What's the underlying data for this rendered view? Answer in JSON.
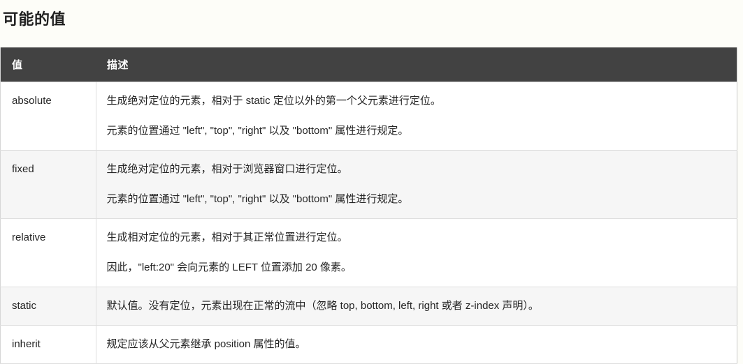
{
  "page": {
    "title": "可能的值"
  },
  "table": {
    "headers": {
      "value": "值",
      "description": "描述"
    },
    "rows": [
      {
        "value": "absolute",
        "lines": [
          "生成绝对定位的元素，相对于 static 定位以外的第一个父元素进行定位。",
          "元素的位置通过 \"left\", \"top\", \"right\" 以及 \"bottom\" 属性进行规定。"
        ]
      },
      {
        "value": "fixed",
        "lines": [
          "生成绝对定位的元素，相对于浏览器窗口进行定位。",
          "元素的位置通过 \"left\", \"top\", \"right\" 以及 \"bottom\" 属性进行规定。"
        ]
      },
      {
        "value": "relative",
        "lines": [
          "生成相对定位的元素，相对于其正常位置进行定位。",
          "因此，\"left:20\" 会向元素的 LEFT 位置添加 20 像素。"
        ]
      },
      {
        "value": "static",
        "lines": [
          "默认值。没有定位，元素出现在正常的流中（忽略 top, bottom, left, right 或者 z-index 声明）。"
        ]
      },
      {
        "value": "inherit",
        "lines": [
          "规定应该从父元素继承 position 属性的值。"
        ]
      }
    ]
  },
  "colors": {
    "page_background": "#fdfdf8",
    "header_background": "#424242",
    "header_text": "#ffffff",
    "row_odd": "#ffffff",
    "row_even": "#f6f6f6",
    "border": "#dedede",
    "text": "#252525"
  }
}
